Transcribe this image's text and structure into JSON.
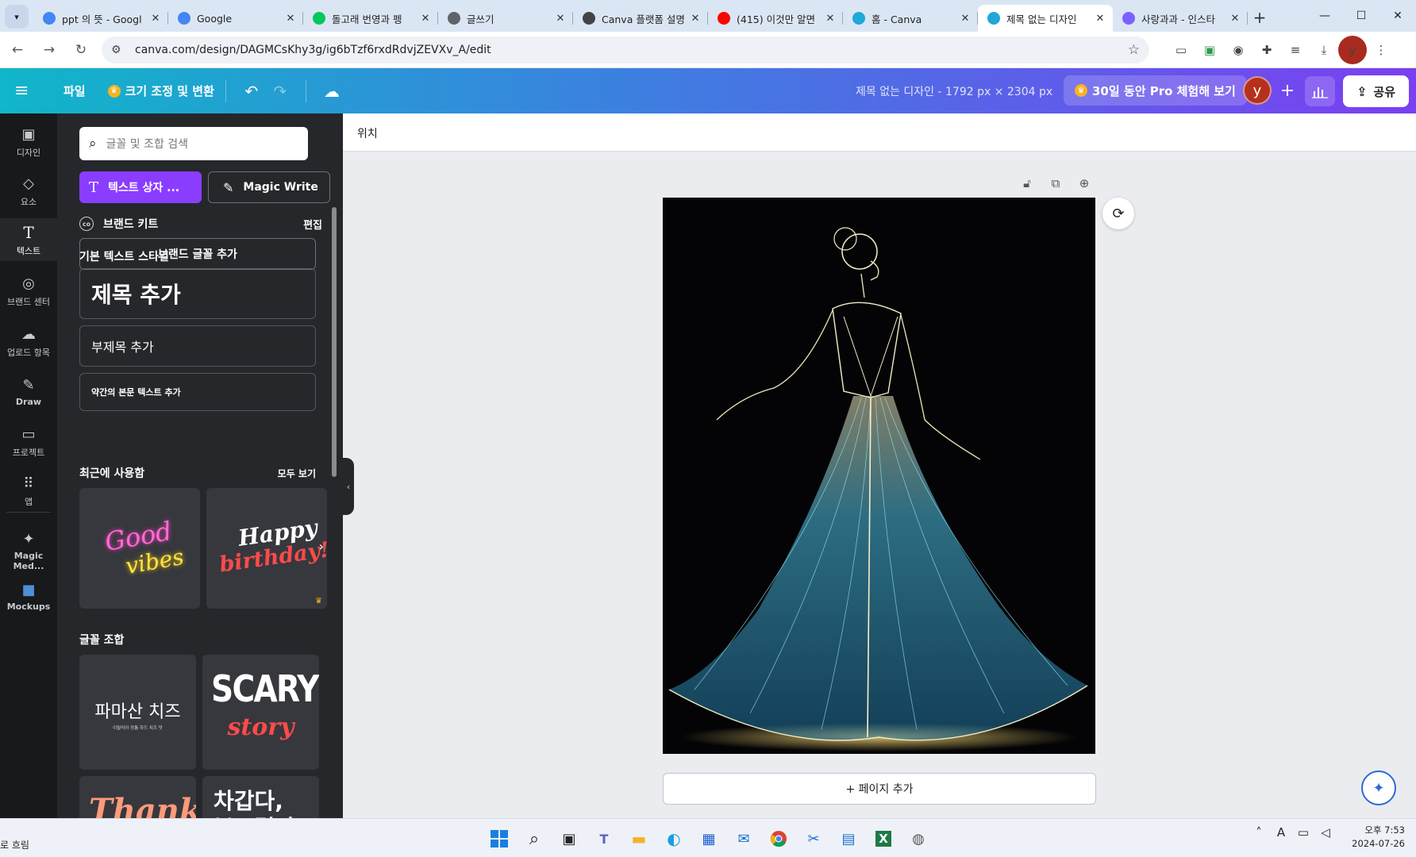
{
  "browser": {
    "tabs": [
      {
        "title": "ppt 의 뜻 - Googl",
        "icon": "google-icon",
        "color": "#4285f4",
        "active": false
      },
      {
        "title": "Google",
        "icon": "google-icon",
        "color": "#4285f4",
        "active": false
      },
      {
        "title": "돌고래 번영과 펭",
        "icon": "naver-blog-icon",
        "color": "#03c75a",
        "active": false
      },
      {
        "title": "글쓰기",
        "icon": "globe-icon",
        "color": "#5f6368",
        "active": false
      },
      {
        "title": "Canva 플랫폼 설명",
        "icon": "chatgpt-icon",
        "color": "#444444",
        "active": false
      },
      {
        "title": "(415) 이것만 알면",
        "icon": "youtube-icon",
        "color": "#ff0000",
        "active": false
      },
      {
        "title": "홈 - Canva",
        "icon": "canva-icon",
        "color": "#1fa8d8",
        "active": false
      },
      {
        "title": "제목 없는 디자인",
        "icon": "canva-icon",
        "color": "#1fa8d8",
        "active": true
      },
      {
        "title": "사랑과과 - 인스타",
        "icon": "chat-icon",
        "color": "#7b61ff",
        "active": false
      }
    ],
    "url": "canva.com/design/DAGMCsKhy3g/ig6bTzf6rxdRdvjZEVXv_A/edit",
    "profile_initial": "y"
  },
  "canva_header": {
    "file": "파일",
    "resize": "크기 조정 및 변환",
    "design_title": "제목 없는 디자인 - 1792 px × 2304 px",
    "pro_trial": "30일 동안 Pro 체험해 보기",
    "avatar": "y",
    "share": "공유"
  },
  "rail": [
    {
      "label": "디자인",
      "icon": "design-icon",
      "glyph": "▣",
      "active": false
    },
    {
      "label": "요소",
      "icon": "elements-icon",
      "glyph": "◇",
      "active": false
    },
    {
      "label": "텍스트",
      "icon": "text-icon",
      "glyph": "T",
      "active": true
    },
    {
      "label": "브랜드 센터",
      "icon": "brand-icon",
      "glyph": "◎",
      "active": false
    },
    {
      "label": "업로드 항목",
      "icon": "upload-icon",
      "glyph": "☁",
      "active": false
    },
    {
      "label": "Draw",
      "icon": "draw-icon",
      "glyph": "✎",
      "active": false
    },
    {
      "label": "프로젝트",
      "icon": "folder-icon",
      "glyph": "▭",
      "active": false
    },
    {
      "label": "앱",
      "icon": "apps-icon",
      "glyph": "⠿",
      "active": false
    },
    {
      "label": "Magic Med...",
      "icon": "magic-media-icon",
      "glyph": "✦",
      "active": false
    },
    {
      "label": "Mockups",
      "icon": "mockups-icon",
      "glyph": "■",
      "active": false
    }
  ],
  "panel": {
    "search_placeholder": "글꼴 및 조합 검색",
    "add_textbox": "텍스트 상자 ...",
    "magic_write": "Magic Write",
    "brand_kit": "브랜드 키트",
    "edit": "편집",
    "add_brand_font": "브랜드 글꼴 추가",
    "default_styles_title": "기본 텍스트 스타일",
    "heading": "제목 추가",
    "subheading": "부제목 추가",
    "body": "약간의 본문 텍스트 추가",
    "recent_title": "최근에 사용함",
    "see_all": "모두 보기",
    "recent_items": [
      {
        "line1": "Good",
        "line2": "vibes"
      },
      {
        "line1": "Happy",
        "line2": "birthday!"
      }
    ],
    "combos_title": "글꼴 조합",
    "combos": [
      {
        "line1": "파마산 치즈",
        "line2": "이탈리아 정통 하드 치즈 맛"
      },
      {
        "line1": "SCARY",
        "line2": "story"
      },
      {
        "line1": "Thank",
        "line2": ""
      },
      {
        "line1": "차갑다,",
        "line2": "부드럽다"
      }
    ]
  },
  "canvas": {
    "position_label": "위치",
    "add_page": "+ 페이지 추가"
  },
  "taskbar": {
    "weather": "로 흐림",
    "time": "오후 7:53",
    "date": "2024-07-26"
  }
}
